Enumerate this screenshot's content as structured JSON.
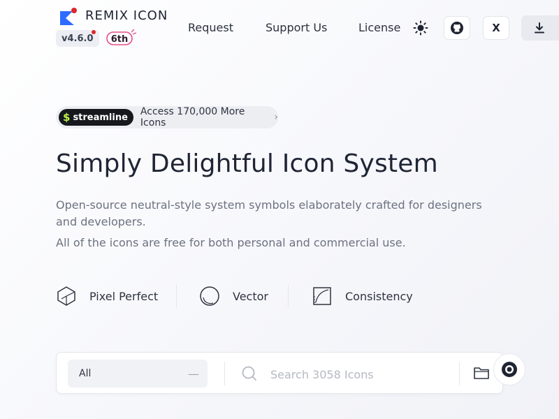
{
  "header": {
    "brand": "REMIX ICON",
    "version": "v4.6.0",
    "anniversary": "6th",
    "nav": [
      {
        "label": "Request"
      },
      {
        "label": "Support Us"
      },
      {
        "label": "License"
      }
    ],
    "x_label": "X"
  },
  "promo": {
    "badge": "streamline",
    "text": "Access 170,000 More Icons",
    "arrow": "›"
  },
  "hero": {
    "title": "Simply Delightful Icon System",
    "description": "Open-source neutral-style system symbols elaborately crafted for designers and developers.",
    "free_note": "All of the icons are free for both personal and commercial use."
  },
  "features": [
    {
      "label": "Pixel Perfect",
      "icon": "cube-icon"
    },
    {
      "label": "Vector",
      "icon": "circle-icon"
    },
    {
      "label": "Consistency",
      "icon": "ruler-icon"
    }
  ],
  "search": {
    "category": "All",
    "placeholder": "Search 3058 Icons"
  },
  "colors": {
    "accent": "#2f6bff",
    "badge_dot": "#e0262b",
    "streamline_green": "#c3f24a"
  }
}
